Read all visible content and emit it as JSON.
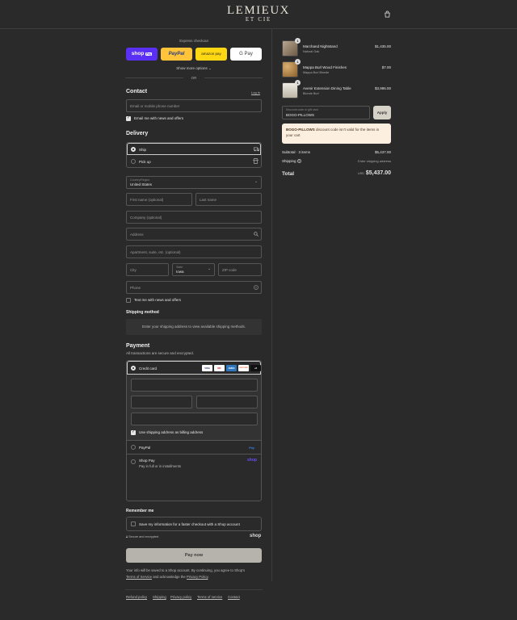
{
  "brand": {
    "name": "LEMIEUX",
    "sub": "ET CIE"
  },
  "express": {
    "label": "Express checkout",
    "shop_pay": "shop",
    "shop_pay_tag": "Pay",
    "paypal": "PayPal",
    "amazon": "amazon pay",
    "gpay": "G Pay",
    "show_more": "Show more options",
    "or": "OR"
  },
  "contact": {
    "title": "Contact",
    "login": "Log in",
    "email_placeholder": "Email or mobile phone number",
    "newsletter": "Email me with news and offers"
  },
  "delivery": {
    "title": "Delivery",
    "ship": "Ship",
    "pickup": "Pick up",
    "country_label": "Country/Region",
    "country_value": "United States",
    "first_name": "First name (optional)",
    "last_name": "Last name",
    "company": "Company (optional)",
    "address": "Address",
    "apartment": "Apartment, suite, etc. (optional)",
    "city": "City",
    "state_label": "State",
    "state_value": "Iowa",
    "zip": "ZIP code",
    "phone": "Phone",
    "sms": "Text me with news and offers"
  },
  "shipping_method": {
    "title": "Shipping method",
    "note": "Enter your shipping address to view available shipping methods."
  },
  "payment": {
    "title": "Payment",
    "subtitle": "All transactions are secure and encrypted.",
    "credit_card": "Credit card",
    "cards": [
      "VISA",
      "MC",
      "AMEX",
      "DISCOVER",
      "+6"
    ],
    "billing_same": "Use shipping address as billing address",
    "paypal": "PayPal",
    "paypal_logo": "Pay",
    "shop_pay": "Shop Pay",
    "shop_pay_sub": "Pay in full or in installments",
    "shop_pay_logo": "shop"
  },
  "remember": {
    "title": "Remember me",
    "save_info": "Save my information for a faster checkout with a Shop account",
    "secure": "Secure and encrypted",
    "shop_logo": "shop"
  },
  "pay_now": "Pay now",
  "legal": {
    "line1": "Your info will be saved to a Shop account. By continuing, you agree to Shop's",
    "tos": "Terms of Service",
    "and": " and acknowledge the ",
    "privacy": "Privacy Policy",
    "end": "."
  },
  "footer_links": [
    "Refund policy",
    "Shipping",
    "Privacy policy",
    "Terms of service",
    "Contact"
  ],
  "order": {
    "items": [
      {
        "qty": "1",
        "name": "Marchand Nightstand",
        "variant": "Natural Oak",
        "price": "$1,435.00",
        "color": "#8a7560"
      },
      {
        "qty": "1",
        "name": "Mappa Burl Wood Finishes",
        "variant": "Mappa Burl Blonde",
        "price": "$7.00",
        "color": "#b08a55"
      },
      {
        "qty": "1",
        "name": "Avenir Extension Dining Table",
        "variant": "Blonde Burl",
        "price": "$3,995.00",
        "color": "#cfc6b8"
      }
    ],
    "discount_label": "Discount code or gift card",
    "discount_value": "BOGO-PILLOWS",
    "apply": "Apply",
    "error_code": "BOGO-PILLOWS",
    "error_text": " discount code isn't valid for the items in your cart",
    "subtotal_label": "Subtotal · 3 items",
    "subtotal_value": "$5,437.00",
    "shipping_label": "Shipping",
    "shipping_value": "Enter shipping address",
    "total_label": "Total",
    "currency": "USD",
    "total_value": "$5,437.00"
  }
}
